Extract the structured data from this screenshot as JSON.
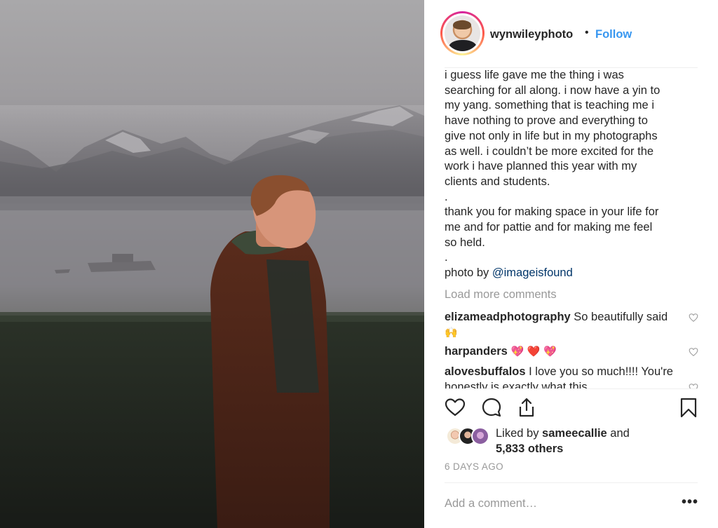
{
  "post": {
    "username": "wynwileyphoto",
    "separator": "•",
    "follow_label": "Follow",
    "caption_lines": [
      "i guess life gave me the thing i was",
      "searching for all along. i now have a yin to",
      "my yang. something that is teaching me i",
      "have nothing to prove and everything to",
      "give not only in life but in my photographs",
      "as well. i couldn’t be more excited for the",
      "work i have planned this year with my",
      "clients and students.",
      ".",
      "thank you for making space in your life for",
      "me and for pattie and for making me feel",
      "so held.",
      "."
    ],
    "credit_prefix": "photo by ",
    "credit_mention": "@imageisfound",
    "load_more": "Load more comments",
    "comments": [
      {
        "user": "elizameadphotography",
        "text": " So beautifully said ",
        "emoji": "🙌"
      },
      {
        "user": "harpanders",
        "text": " ",
        "emoji": "💖 ❤️ 💖"
      },
      {
        "user": "alovesbuffalos",
        "text": " I love you so much!!!! You're honestly is exactly what this"
      }
    ],
    "likes_prefix": "Liked by ",
    "likes_user": "sameecallie",
    "likes_and": " and",
    "likes_others": "5,833 others",
    "timestamp": "6 DAYS AGO",
    "comment_placeholder": "Add a comment…",
    "more_label": "•••"
  },
  "icons": {
    "like": "heart-outline-icon",
    "comment": "speech-bubble-icon",
    "share": "share-upload-icon",
    "save": "bookmark-icon",
    "comment_like": "small-heart-icon"
  },
  "colors": {
    "link_blue": "#3897f0",
    "mention_blue": "#003569",
    "muted_gray": "#999999",
    "text": "#262626"
  }
}
